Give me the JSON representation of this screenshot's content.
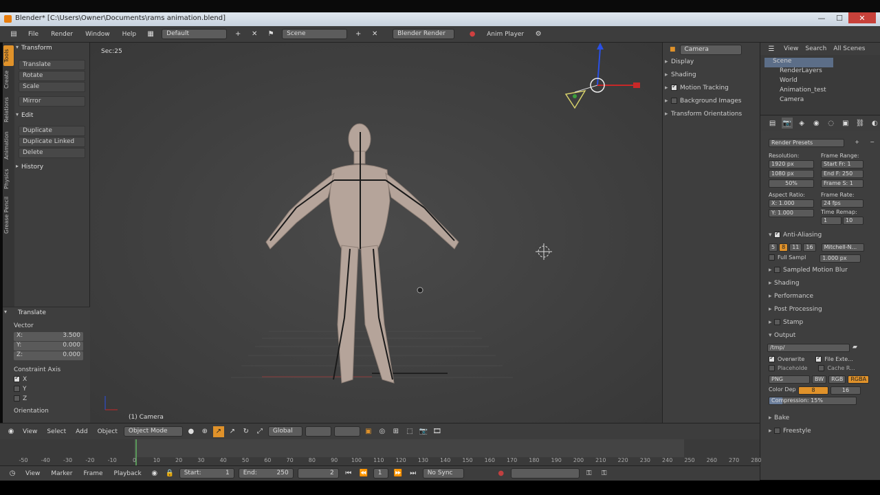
{
  "window": {
    "title": "Blender* [C:\\Users\\Owner\\Documents\\rams animation.blend]"
  },
  "info_header": {
    "menus": [
      "File",
      "Render",
      "Window",
      "Help"
    ],
    "layout": "Default",
    "scene": "Scene",
    "engine": "Blender Render",
    "anim_player": "Anim Player"
  },
  "tool_tabs": [
    "Tools",
    "Create",
    "Relations",
    "Animation",
    "Physics",
    "Grease Pencil"
  ],
  "tool_shelf": {
    "transform_title": "Transform",
    "transform_buttons": [
      "Translate",
      "Rotate",
      "Scale"
    ],
    "mirror": "Mirror",
    "edit_title": "Edit",
    "edit_buttons": [
      "Duplicate",
      "Duplicate Linked",
      "Delete"
    ],
    "history_title": "History"
  },
  "operator_panel": {
    "title": "Translate",
    "vector_label": "Vector",
    "x": {
      "label": "X:",
      "value": "3.500"
    },
    "y": {
      "label": "Y:",
      "value": "0.000"
    },
    "z": {
      "label": "Z:",
      "value": "0.000"
    },
    "constraint_label": "Constraint Axis",
    "axes": [
      {
        "label": "X",
        "checked": true
      },
      {
        "label": "Y",
        "checked": false
      },
      {
        "label": "Z",
        "checked": false
      }
    ],
    "orientation_label": "Orientation"
  },
  "viewport": {
    "info": "Sec:25",
    "object_label": "(1) Camera"
  },
  "properties_region": {
    "object": "Camera",
    "rows": [
      {
        "label": "Display",
        "check": null
      },
      {
        "label": "Shading",
        "check": null
      },
      {
        "label": "Motion Tracking",
        "check": true
      },
      {
        "label": "Background Images",
        "check": false
      },
      {
        "label": "Transform Orientations",
        "check": null
      }
    ]
  },
  "outliner": {
    "menus": [
      "View",
      "Search",
      "All Scenes"
    ],
    "items": [
      "Scene",
      "RenderLayers",
      "World",
      "Animation_test",
      "Camera"
    ]
  },
  "properties": {
    "presets": "Render Presets",
    "resolution_label": "Resolution:",
    "res_x": "1920 px",
    "res_y": "1080 px",
    "res_pct": "50%",
    "frame_range_label": "Frame Range:",
    "start": "Start Fr: 1",
    "end": "End F: 250",
    "step": "Frame S: 1",
    "aspect_label": "Aspect Ratio:",
    "aspect_x": "X: 1.000",
    "aspect_y": "Y: 1.000",
    "frame_rate_label": "Frame Rate:",
    "fps": "24 fps",
    "time_remap_label": "Time Remap:",
    "remap_old": "1",
    "remap_new": "10",
    "aa_title": "Anti-Aliasing",
    "aa_samples": [
      "5",
      "8",
      "11",
      "16"
    ],
    "aa_filter": "Mitchell-N...",
    "full_sample": "Full Sampl",
    "filter_size": "1.000 px",
    "sections": [
      "Sampled Motion Blur",
      "Shading",
      "Performance",
      "Post Processing",
      "Stamp",
      "Output"
    ],
    "output_path": "/tmp/",
    "overwrite": "Overwrite",
    "file_ext": "File Exte...",
    "placeholders": "Placeholde",
    "cache_result": "Cache R...",
    "format": "PNG",
    "bw": "BW",
    "rgb": "RGB",
    "rgba": "RGBA",
    "color_depth_label": "Color Dep",
    "depth_8": "8",
    "depth_16": "16",
    "compression": "Compression: 15%",
    "bake": "Bake",
    "freestyle": "Freestyle"
  },
  "viewport_header": {
    "menus": [
      "View",
      "Select",
      "Add",
      "Object"
    ],
    "mode": "Object Mode",
    "orientation": "Global"
  },
  "timeline": {
    "ticks": [
      "-50",
      "-40",
      "-30",
      "-20",
      "-10",
      "0",
      "10",
      "20",
      "30",
      "40",
      "50",
      "60",
      "70",
      "80",
      "90",
      "100",
      "110",
      "120",
      "130",
      "140",
      "150",
      "160",
      "170",
      "180",
      "190",
      "200",
      "210",
      "220",
      "230",
      "240",
      "250",
      "260",
      "270",
      "280"
    ],
    "menus": [
      "View",
      "Marker",
      "Frame",
      "Playback"
    ],
    "start": "Start:",
    "start_val": "1",
    "end": "End:",
    "end_val": "250",
    "current": "2",
    "frame_field": "1",
    "sync": "No Sync"
  }
}
